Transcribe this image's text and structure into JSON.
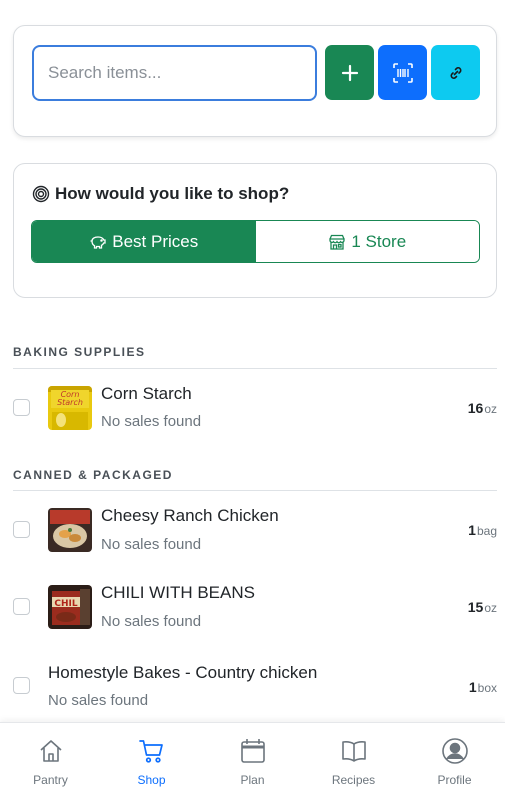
{
  "search": {
    "placeholder": "Search items..."
  },
  "actions": {
    "add_icon": "plus-icon",
    "scan_icon": "barcode-scan-icon",
    "link_icon": "link-icon"
  },
  "shop_mode": {
    "title": "How would you like to shop?",
    "options": [
      {
        "label": "Best Prices",
        "icon": "piggy-bank-icon",
        "selected": true
      },
      {
        "label": "1 Store",
        "icon": "shop-icon",
        "selected": false
      }
    ]
  },
  "categories": [
    {
      "name": "BAKING SUPPLIES",
      "items": [
        {
          "name": "Corn Starch",
          "status": "No sales found",
          "qty": "16",
          "unit": "oz",
          "checked": false
        }
      ]
    },
    {
      "name": "CANNED & PACKAGED",
      "items": [
        {
          "name": "Cheesy Ranch Chicken",
          "status": "No sales found",
          "qty": "1",
          "unit": "bag",
          "checked": false
        },
        {
          "name": "CHILI WITH BEANS",
          "status": "No sales found",
          "qty": "15",
          "unit": "oz",
          "checked": false
        },
        {
          "name": "Homestyle Bakes - Country chicken",
          "status": "No sales found",
          "qty": "1",
          "unit": "box",
          "checked": false
        }
      ]
    }
  ],
  "nav": [
    {
      "label": "Pantry",
      "icon": "house-icon",
      "active": false
    },
    {
      "label": "Shop",
      "icon": "cart-icon",
      "active": true
    },
    {
      "label": "Plan",
      "icon": "calendar-icon",
      "active": false
    },
    {
      "label": "Recipes",
      "icon": "book-icon",
      "active": false
    },
    {
      "label": "Profile",
      "icon": "person-circle-icon",
      "active": false
    }
  ],
  "colors": {
    "primary": "#0d6efd",
    "success": "#198754",
    "info": "#0dcaf0",
    "muted": "#6c757d"
  }
}
